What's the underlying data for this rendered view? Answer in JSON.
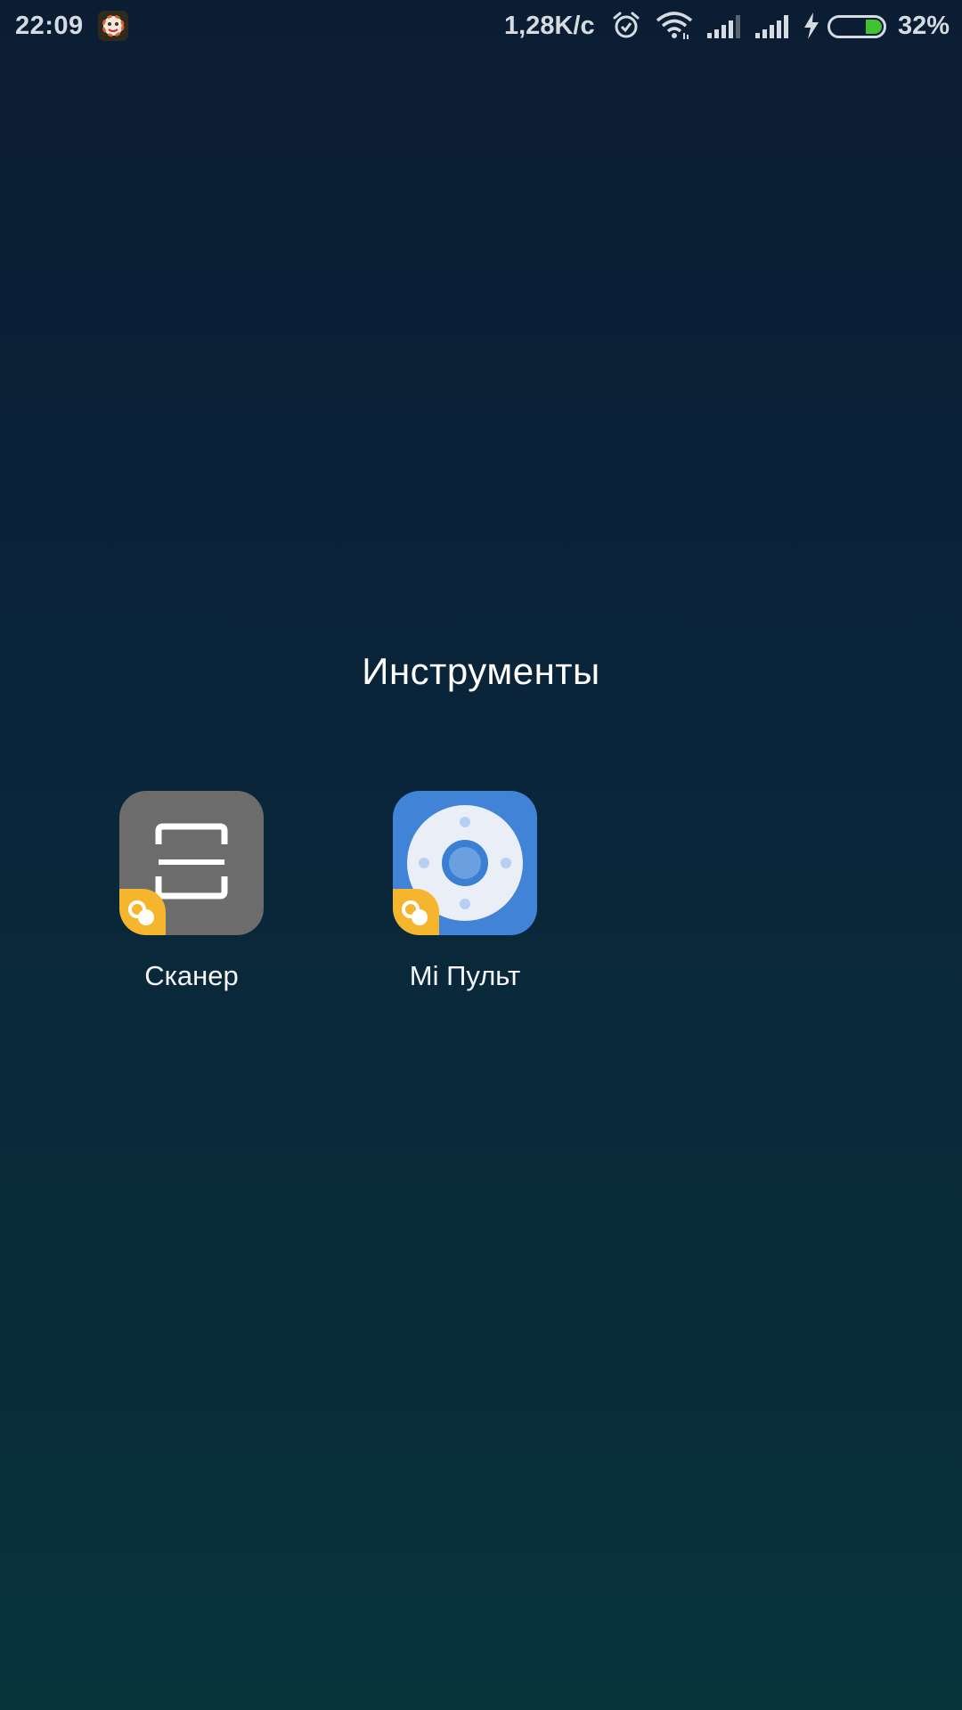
{
  "status_bar": {
    "time": "22:09",
    "network_speed": "1,28K/c",
    "battery_percent": "32%",
    "battery_level": 0.32,
    "icons": [
      "notification-app-icon",
      "alarm-icon",
      "wifi-icon",
      "signal-icon",
      "signal-icon",
      "charging-icon",
      "battery-icon"
    ]
  },
  "folder": {
    "title": "Инструменты",
    "apps": [
      {
        "label": "Сканер",
        "icon": "scanner-icon",
        "color": "#6c6c6c"
      },
      {
        "label": "Mi Пульт",
        "icon": "remote-control-icon",
        "color": "#4083d7"
      }
    ],
    "badge_color": "#f5b62e"
  },
  "colors": {
    "background_top": "#0b1d33",
    "background_bottom": "#07333b",
    "battery_fill": "#42c132"
  }
}
